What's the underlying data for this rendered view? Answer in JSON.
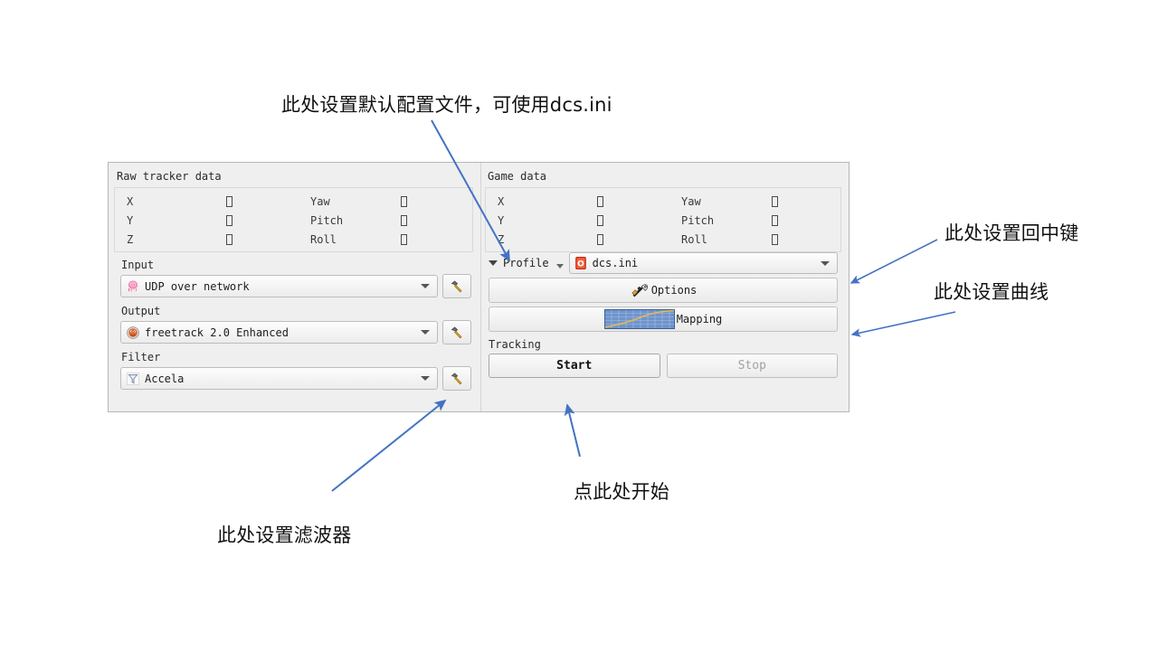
{
  "app": {
    "raw_group_title": "Raw tracker data",
    "game_group_title": "Game data",
    "axis_labels": [
      "X",
      "Y",
      "Z"
    ],
    "rotation_labels": [
      "Yaw",
      "Pitch",
      "Roll"
    ],
    "raw_values": [
      "",
      "",
      ""
    ],
    "raw_rotation_values": [
      "",
      "",
      ""
    ],
    "game_values": [
      "",
      "",
      ""
    ],
    "game_rotation_values": [
      "",
      "",
      ""
    ],
    "input": {
      "label": "Input",
      "value": "UDP over network",
      "icon": "octopus-icon",
      "config_icon": "hammer-icon"
    },
    "output": {
      "label": "Output",
      "value": "freetrack 2.0 Enhanced",
      "icon": "freetrack-icon",
      "config_icon": "hammer-icon"
    },
    "filter": {
      "label": "Filter",
      "value": "Accela",
      "icon": "funnel-icon",
      "config_icon": "hammer-icon"
    },
    "profile": {
      "label": "Profile",
      "value": "dcs.ini",
      "icon": "opentrack-profile-icon"
    },
    "options_button": {
      "label": "Options",
      "icon": "tools-icon"
    },
    "mapping_button": {
      "label": "Mapping",
      "icon": "curve-graph-icon"
    },
    "tracking": {
      "label": "Tracking",
      "start_label": "Start",
      "stop_label": "Stop",
      "stop_disabled": true
    }
  },
  "annotations": [
    {
      "id": "profile-note",
      "text": "此处设置默认配置文件，可使用dcs.ini"
    },
    {
      "id": "center-note",
      "text": "此处设置回中键"
    },
    {
      "id": "curve-note",
      "text": "此处设置曲线"
    },
    {
      "id": "start-note",
      "text": "点此处开始"
    },
    {
      "id": "filter-note",
      "text": "此处设置滤波器"
    }
  ],
  "colors": {
    "annotation_line": "#4472c4",
    "window_bg": "#efefef",
    "accent_red": "#e8402a",
    "mapping_blue": "#4f7fc8"
  }
}
